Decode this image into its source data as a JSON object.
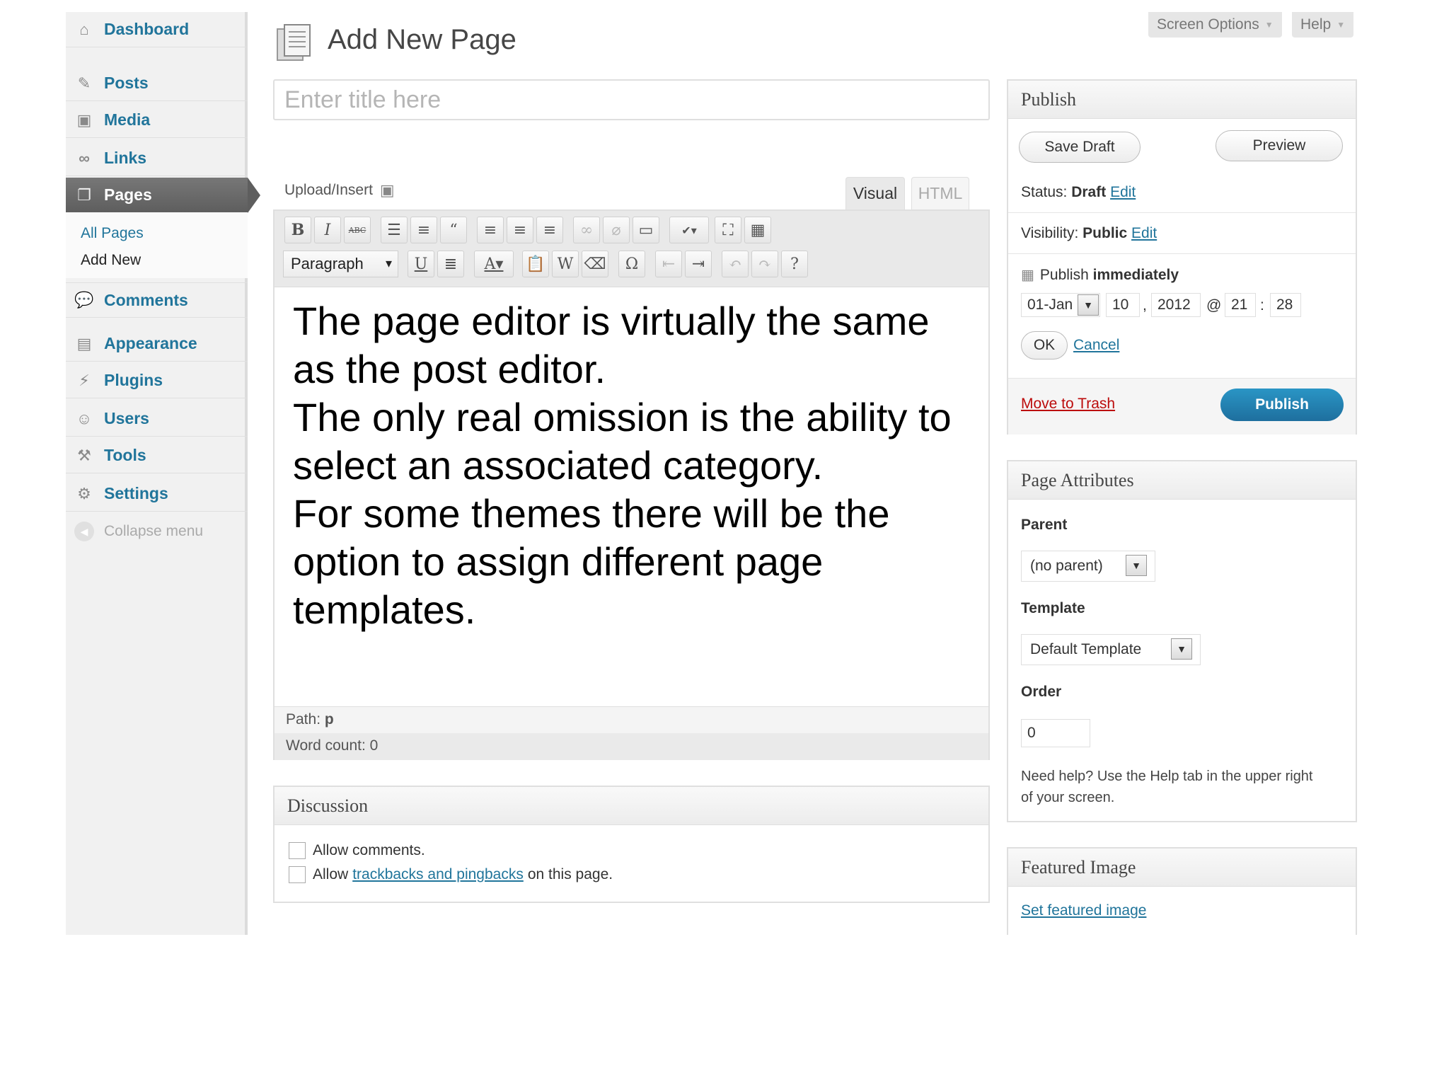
{
  "sidebar": {
    "items": [
      {
        "label": "Dashboard",
        "icon": "house-icon"
      },
      {
        "label": "Posts",
        "icon": "pin-icon"
      },
      {
        "label": "Media",
        "icon": "media-icon"
      },
      {
        "label": "Links",
        "icon": "chain-link-icon"
      },
      {
        "label": "Pages",
        "icon": "pages-icon"
      },
      {
        "label": "Comments",
        "icon": "speech-bubble-icon"
      },
      {
        "label": "Appearance",
        "icon": "appearance-icon"
      },
      {
        "label": "Plugins",
        "icon": "plug-icon"
      },
      {
        "label": "Users",
        "icon": "users-icon"
      },
      {
        "label": "Tools",
        "icon": "tools-icon"
      },
      {
        "label": "Settings",
        "icon": "settings-icon"
      }
    ],
    "submenu": [
      "All Pages",
      "Add New"
    ],
    "collapse": "Collapse menu"
  },
  "top": {
    "screen_options": "Screen Options",
    "help": "Help"
  },
  "header": {
    "title": "Add New Page"
  },
  "title_field": {
    "placeholder": "Enter title here",
    "value": ""
  },
  "editor": {
    "upload_insert": "Upload/Insert",
    "tab_visual": "Visual",
    "tab_html": "HTML",
    "format": "Paragraph",
    "content": [
      "The page editor is virtually the same",
      "as the post editor.",
      "The only real omission is the ability to",
      "select an associated category.",
      "For some themes there will be the",
      "option to assign different page",
      "templates."
    ],
    "path_label": "Path:",
    "path_value": "p",
    "word_count": "Word count: 0"
  },
  "discussion": {
    "title": "Discussion",
    "allow_comments": "Allow comments.",
    "allow_prefix": "Allow",
    "trackbacks_link": "trackbacks and pingbacks",
    "allow_suffix": "on this page."
  },
  "publish": {
    "title": "Publish",
    "save_draft": "Save Draft",
    "preview": "Preview",
    "status_label": "Status:",
    "status_value": "Draft",
    "visibility_label": "Visibility:",
    "visibility_value": "Public",
    "edit": "Edit",
    "schedule_label": "Publish",
    "schedule_value": "immediately",
    "month": "01-Jan",
    "day": "10",
    "year": "2012",
    "at": "@",
    "hour": "21",
    "colon": ":",
    "minute": "28",
    "comma": ",",
    "ok": "OK",
    "cancel": "Cancel",
    "trash": "Move to Trash",
    "publish_button": "Publish"
  },
  "attributes": {
    "title": "Page Attributes",
    "parent_label": "Parent",
    "parent_value": "(no parent)",
    "template_label": "Template",
    "template_value": "Default Template",
    "order_label": "Order",
    "order_value": "0",
    "help_line1": "Need help? Use the Help tab in the upper right",
    "help_line2": "of your screen."
  },
  "featured": {
    "title": "Featured Image",
    "link": "Set featured image"
  },
  "colors": {
    "link": "#21759b",
    "publish_button": "#1e7db3",
    "trash": "#bc0b0b"
  }
}
